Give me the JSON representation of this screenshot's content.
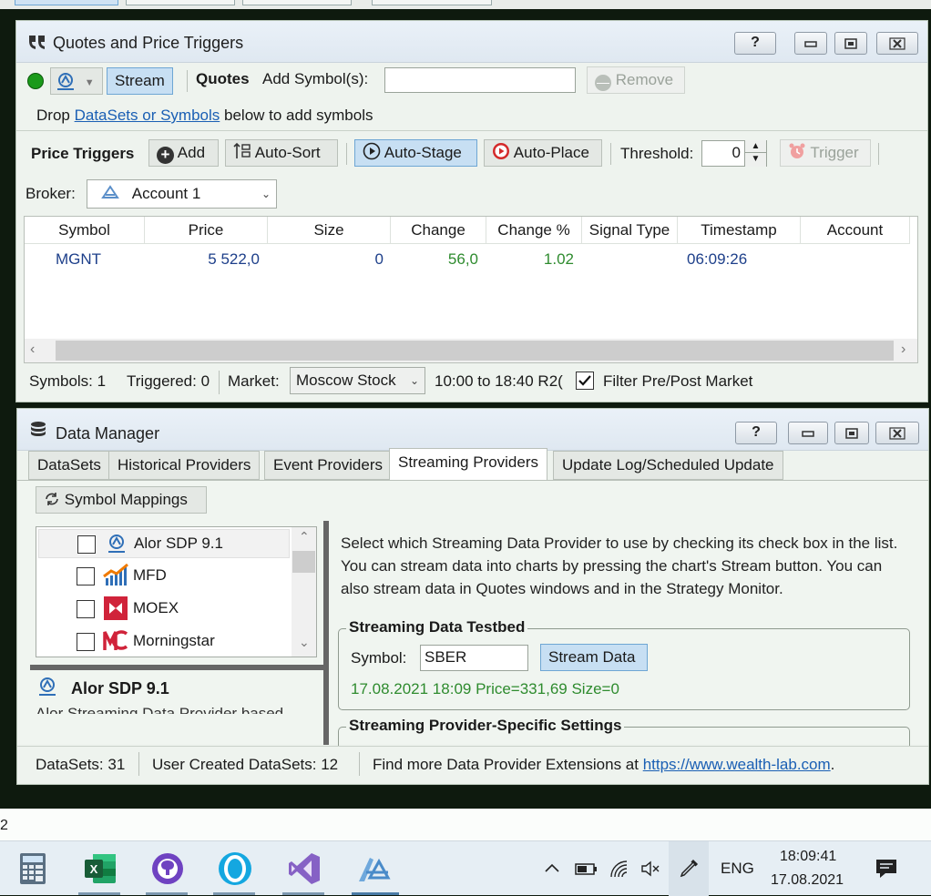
{
  "quotes_window": {
    "title": "Quotes and Price Triggers",
    "help_label": "?",
    "stream_label": "Stream",
    "quotes_label": "Quotes",
    "add_symbols_label": "Add Symbol(s):",
    "add_symbols_value": "",
    "remove_label": "Remove",
    "drop_prefix": "Drop",
    "drop_link": "DataSets or Symbols",
    "drop_suffix": "below to add symbols",
    "price_triggers_label": "Price Triggers",
    "add_label": "Add",
    "auto_sort_label": "Auto-Sort",
    "auto_stage_label": "Auto-Stage",
    "auto_place_label": "Auto-Place",
    "threshold_label": "Threshold:",
    "threshold_value": "0",
    "trigger_label": "Trigger",
    "broker_label": "Broker:",
    "broker_value": "Account 1",
    "columns": [
      "Symbol",
      "Price",
      "Size",
      "Change",
      "Change %",
      "Signal Type",
      "Timestamp",
      "Account"
    ],
    "rows": [
      {
        "symbol": "MGNT",
        "price": "5 522,0",
        "size": "0",
        "change": "56,0",
        "change_pct": "1.02",
        "signal_type": "",
        "timestamp": "06:09:26",
        "account": ""
      }
    ],
    "status": {
      "symbols": "Symbols: 1",
      "triggered": "Triggered: 0",
      "market_label": "Market:",
      "market_value": "Moscow Stock",
      "hours": "10:00 to 18:40 R2(",
      "filter_label": "Filter Pre/Post Market",
      "filter_checked": true
    }
  },
  "data_manager": {
    "title": "Data Manager",
    "help_label": "?",
    "tabs": [
      {
        "label": "DataSets",
        "active": false
      },
      {
        "label": "Historical Providers",
        "active": false
      },
      {
        "label": "Event Providers",
        "active": false
      },
      {
        "label": "Streaming Providers",
        "active": true
      },
      {
        "label": "Update Log/Scheduled Update",
        "active": false
      }
    ],
    "symbol_mappings_label": "Symbol Mappings",
    "providers": [
      {
        "name": "Alor SDP 9.1",
        "icon": "alor-icon",
        "checked": false
      },
      {
        "name": "MFD",
        "icon": "mfd-icon",
        "checked": false
      },
      {
        "name": "MOEX",
        "icon": "moex-icon",
        "checked": false
      },
      {
        "name": "Morningstar",
        "icon": "morningstar-icon",
        "checked": false
      }
    ],
    "selected_provider": "Alor SDP 9.1",
    "selected_provider_desc": "Alor Streaming Data Provider based",
    "description": "Select which Streaming Data Provider to use by checking its check box in the list. You can stream data into charts by pressing the chart's Stream button. You can also stream data in Quotes windows and in the Strategy Monitor.",
    "testbed_title": "Streaming Data Testbed",
    "symbol_label": "Symbol:",
    "symbol_value": "SBER",
    "stream_data_label": "Stream Data",
    "testbed_output": "17.08.2021 18:09 Price=331,69 Size=0",
    "settings_title": "Streaming Provider-Specific Settings",
    "status": {
      "datasets": "DataSets: 31",
      "user_datasets": "User Created DataSets: 12",
      "find_more": "Find more Data Provider Extensions at",
      "link": "https://www.wealth-lab.com",
      "link_suffix": "."
    }
  },
  "stray_text": "2",
  "taskbar": {
    "apps": [
      "calculator-icon",
      "excel-icon",
      "github-icon",
      "alice-icon",
      "visual-studio-icon",
      "wealth-lab-icon"
    ],
    "language": "ENG",
    "time": "18:09:41",
    "date": "17.08.2021"
  },
  "colors": {
    "accent": "#2f6fb7",
    "positive": "#2e8b2e",
    "link": "#1a5fb4",
    "stream_active": "#c7dff3"
  }
}
